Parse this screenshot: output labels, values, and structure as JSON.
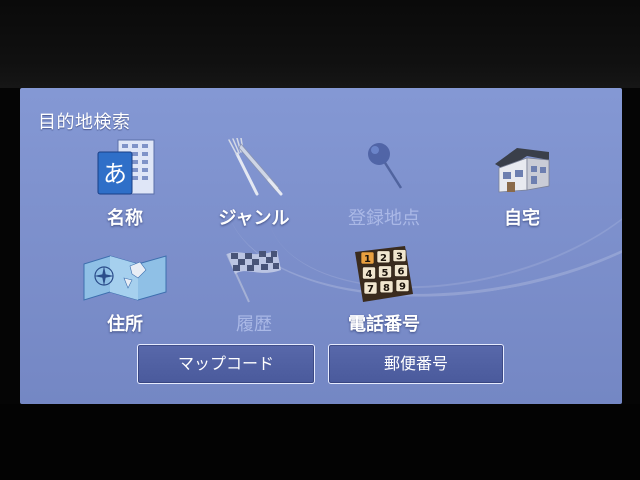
{
  "screen_title": "目的地検索",
  "menu": {
    "name": {
      "label": "名称",
      "icon": "building-a-icon",
      "enabled": true
    },
    "genre": {
      "label": "ジャンル",
      "icon": "fork-knife-icon",
      "enabled": true
    },
    "registered": {
      "label": "登録地点",
      "icon": "pushpin-icon",
      "enabled": false
    },
    "home": {
      "label": "自宅",
      "icon": "house-icon",
      "enabled": true
    },
    "address": {
      "label": "住所",
      "icon": "map-icon",
      "enabled": true
    },
    "history": {
      "label": "履歴",
      "icon": "checkered-flag-icon",
      "enabled": false
    },
    "phone": {
      "label": "電話番号",
      "icon": "keypad-icon",
      "enabled": true
    },
    "keypad_digits": [
      "1",
      "2",
      "3",
      "4",
      "5",
      "6",
      "7",
      "8",
      "9"
    ]
  },
  "buttons": {
    "mapcode": "マップコード",
    "postal": "郵便番号"
  },
  "colors": {
    "screen_bg": "#7d90cc",
    "button_bg": "#4f5fa1",
    "disabled_text": "#aab8e6"
  }
}
